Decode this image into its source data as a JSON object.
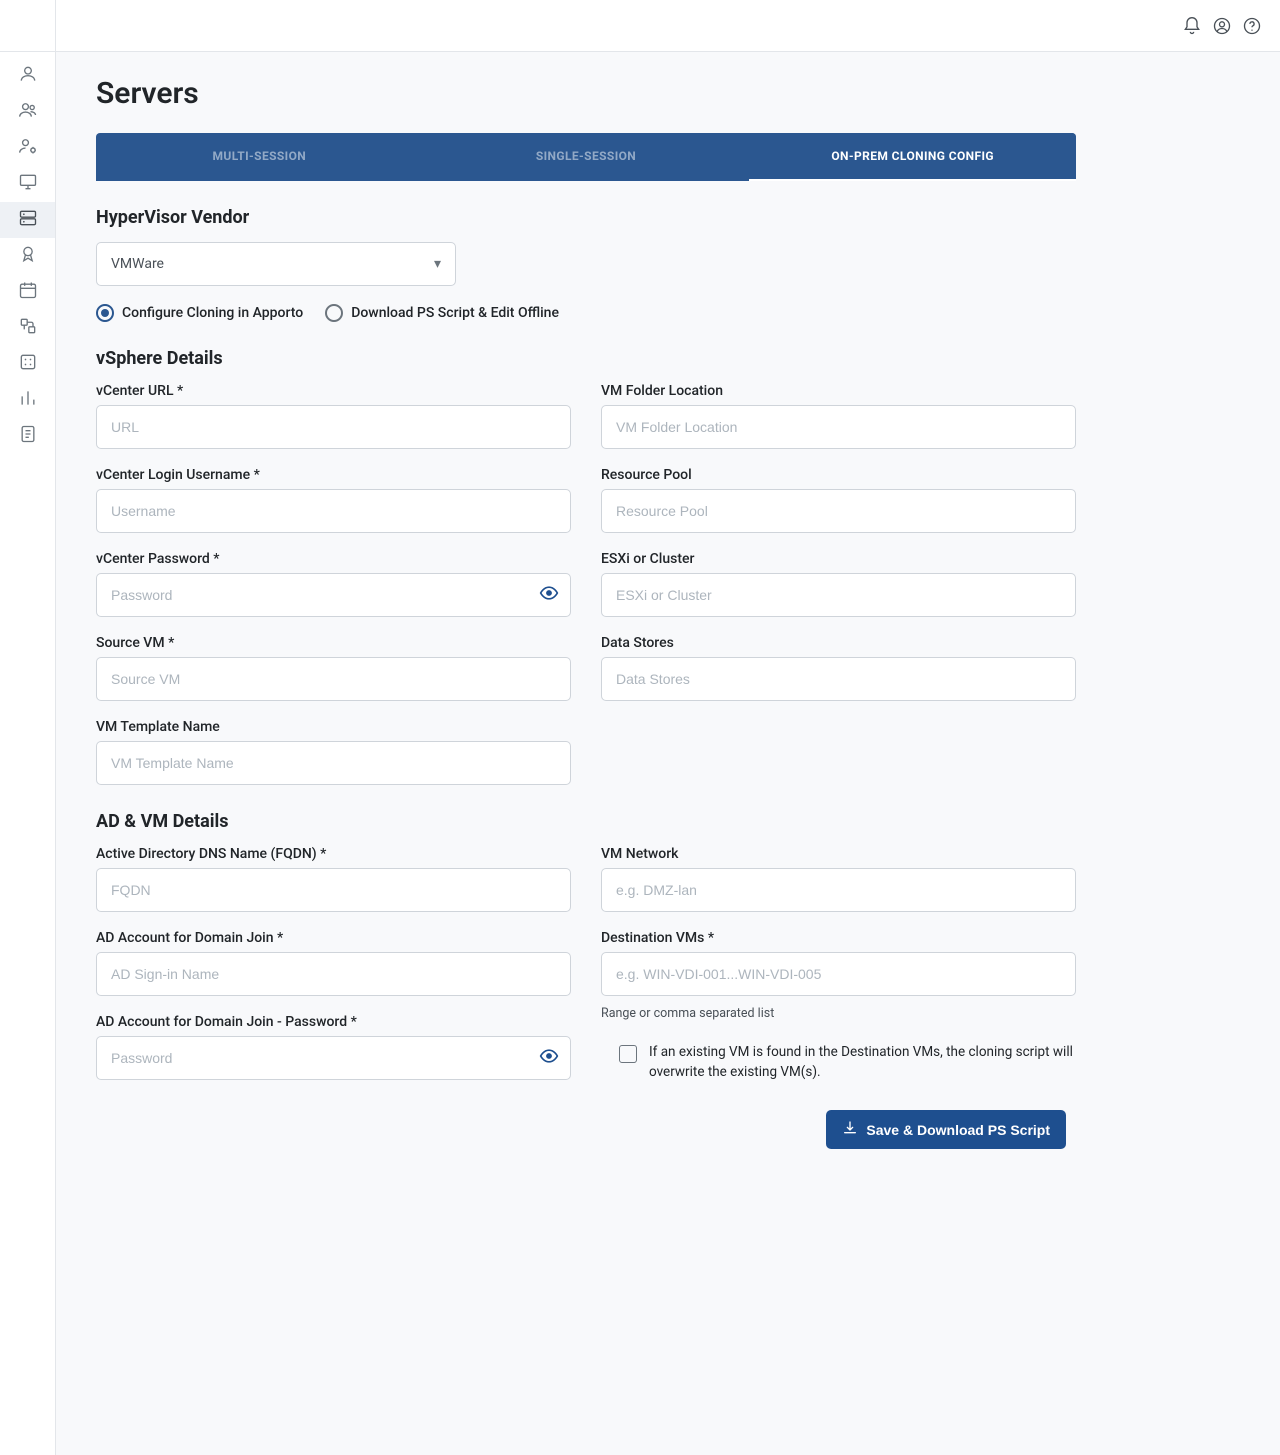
{
  "page": {
    "title": "Servers"
  },
  "tabs": {
    "multi": "MULTI-SESSION",
    "single": "SINGLE-SESSION",
    "cloning": "ON-PREM CLONING CONFIG"
  },
  "sections": {
    "hypervisor": "HyperVisor Vendor",
    "vsphere": "vSphere Details",
    "ad_vm": "AD & VM Details"
  },
  "hypervisor": {
    "selected": "VMWare",
    "radio_configure": "Configure Cloning in Apporto",
    "radio_download": "Download PS Script & Edit Offline"
  },
  "vsphere": {
    "vcenter_url": {
      "label": "vCenter URL *",
      "placeholder": "URL"
    },
    "vm_folder": {
      "label": "VM Folder Location",
      "placeholder": "VM Folder Location"
    },
    "username": {
      "label": "vCenter Login Username *",
      "placeholder": "Username"
    },
    "resource_pool": {
      "label": "Resource Pool",
      "placeholder": "Resource Pool"
    },
    "password": {
      "label": "vCenter Password *",
      "placeholder": "Password"
    },
    "esxi": {
      "label": "ESXi or Cluster",
      "placeholder": "ESXi or Cluster"
    },
    "source_vm": {
      "label": "Source VM *",
      "placeholder": "Source VM"
    },
    "data_stores": {
      "label": "Data Stores",
      "placeholder": "Data Stores"
    },
    "vm_template": {
      "label": "VM Template Name",
      "placeholder": "VM Template Name"
    }
  },
  "ad": {
    "fqdn": {
      "label": "Active Directory DNS Name (FQDN) *",
      "placeholder": "FQDN"
    },
    "vm_network": {
      "label": "VM Network",
      "placeholder": "e.g. DMZ-lan"
    },
    "ad_account": {
      "label": "AD Account for Domain Join *",
      "placeholder": "AD Sign-in Name"
    },
    "dest_vms": {
      "label": "Destination VMs *",
      "placeholder": "e.g. WIN-VDI-001...WIN-VDI-005",
      "helper": "Range or comma separated list"
    },
    "ad_password": {
      "label": "AD Account for Domain Join - Password *",
      "placeholder": "Password"
    },
    "overwrite_label": "If an existing VM is found in the Destination VMs, the cloning script will overwrite the existing VM(s)."
  },
  "footer": {
    "save_button": "Save & Download PS Script"
  }
}
